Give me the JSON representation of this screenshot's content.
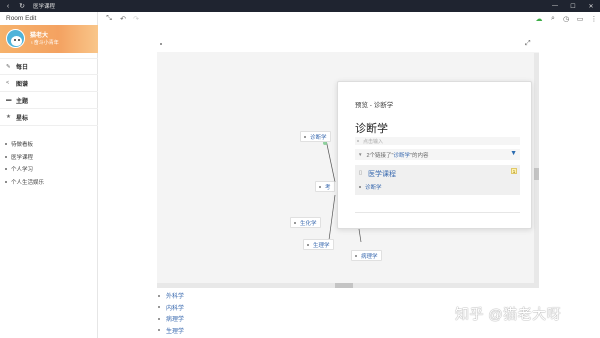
{
  "titlebar": {
    "title": "医学课程"
  },
  "sidebar": {
    "room_edit": "Room Edit",
    "profile": {
      "name": "猫老大",
      "subtitle": "奋斗小青年"
    },
    "nav": [
      {
        "label": "每日",
        "icon": "edit-icon"
      },
      {
        "label": "图谱",
        "icon": "share-icon"
      },
      {
        "label": "主题",
        "icon": "topic-icon"
      },
      {
        "label": "星标",
        "icon": "star-icon"
      }
    ],
    "pages": [
      "待做看板",
      "医学课程",
      "个人学习",
      "个人生活娱乐"
    ]
  },
  "graph": {
    "nodes": [
      {
        "label": "诊断学"
      },
      {
        "label": "考"
      },
      {
        "label": "生化学"
      },
      {
        "label": "生理学"
      },
      {
        "label": "病理学"
      }
    ]
  },
  "popup": {
    "header": "预览 - 诊断学",
    "title": "诊断学",
    "input_placeholder": "点击输入",
    "links_prefix": "2个链接了\"",
    "links_highlight": "诊断学",
    "links_suffix": "\"的内容",
    "card_title": "医学课程",
    "card_badge": "1",
    "card_link": "诊断学"
  },
  "list": [
    "外科学",
    "内科学",
    "病理学",
    "生理学"
  ],
  "watermark": "知乎 @猫老大呀"
}
